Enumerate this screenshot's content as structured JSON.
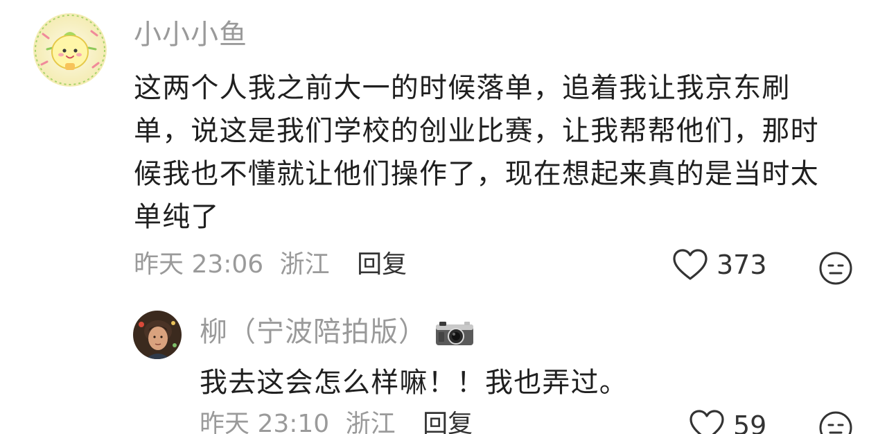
{
  "comment": {
    "username": "小小小鱼",
    "text_lines": [
      "这两个人我之前大一的时候落单，追着我让我京东刷",
      "单，说这是我们学校的创业比赛，让我帮帮他们，那时",
      "候我也不懂就让他们操作了，现在想起来真的是当时太",
      "单纯了"
    ],
    "time": "昨天 23:06",
    "location": "浙江",
    "reply_label": "回复",
    "likes": "373",
    "icons": {
      "like": "heart-icon",
      "react": "meh-face-icon"
    }
  },
  "reply": {
    "username": "柳（宁波陪拍版）",
    "badge_icon": "camera-icon",
    "text": "我去这会怎么样嘛！！我也弄过。",
    "time": "昨天 23:10",
    "location": "浙江",
    "reply_label": "回复",
    "likes": "59"
  },
  "colors": {
    "username": "#9a9a9a",
    "body_text": "#1f1f1f",
    "meta_text": "#9a9a9a",
    "reply_link": "#333333",
    "icon_stroke": "#333333"
  }
}
